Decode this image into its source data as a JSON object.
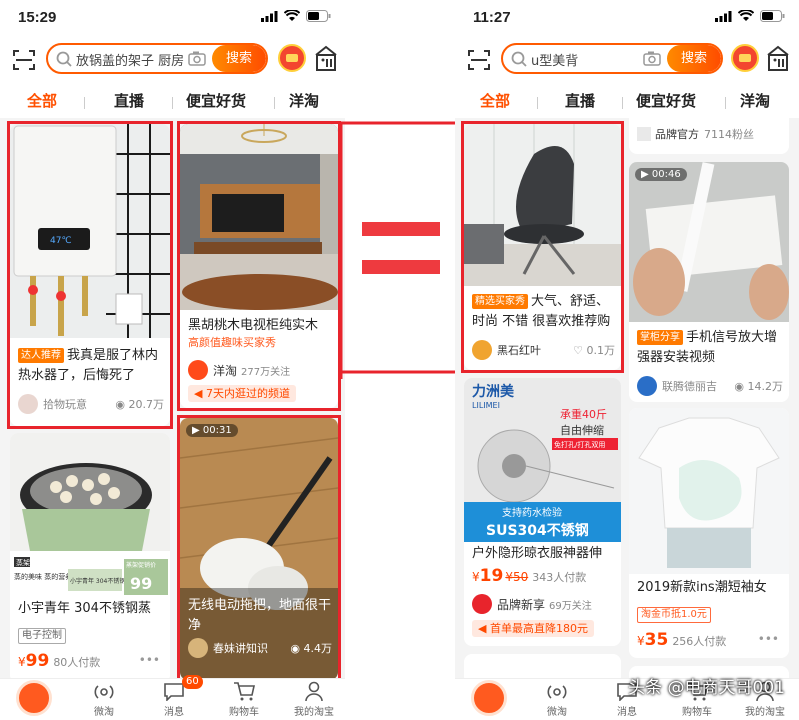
{
  "left": {
    "time": "15:29",
    "search_query": "放锅盖的架子 厨房",
    "search_button": "搜索",
    "tabs": [
      "全部",
      "直播",
      "便宜好货",
      "洋淘"
    ],
    "cards": {
      "heater": {
        "tag": "达人推荐",
        "title": "我真是服了林内热水器了，后悔死了",
        "author": "拾物玩意",
        "views": "20.7万"
      },
      "tvcabinet": {
        "title": "黑胡桃木电视柜纯实木",
        "subtitle": "高颜值趣味买家秀",
        "author": "洋淘",
        "followers": "277万关注",
        "pill": "7天内逛过的频道"
      },
      "pot": {
        "label_tag": "蒸架",
        "label_a": "蒸的美味 蒸的营养",
        "label_b": "小宇青年 304不锈钢蒸架",
        "label_c": "蒸架促销价",
        "label_price": "99",
        "title": "小宇青年 304不锈钢蒸",
        "tag": "电子控制",
        "price_symbol": "¥",
        "price": "99",
        "payers": "80人付款"
      },
      "mop": {
        "duration": "00:31",
        "title": "无线电动拖把，地面很干净",
        "author": "春妹讲知识",
        "views": "4.4万"
      }
    },
    "nav": [
      {
        "icon": "live-icon",
        "label": "微淘"
      },
      {
        "icon": "message-icon",
        "label": "消息",
        "badge": "60"
      },
      {
        "icon": "cart-icon",
        "label": "购物车"
      },
      {
        "icon": "person-icon",
        "label": "我的淘宝"
      }
    ]
  },
  "right": {
    "time": "11:27",
    "search_query": "u型美背",
    "search_button": "搜索",
    "tabs": [
      "全部",
      "直播",
      "便宜好货",
      "洋淘"
    ],
    "cards": {
      "brand_top": {
        "author": "品牌官方",
        "followers": "7114粉丝"
      },
      "chair": {
        "tag": "精选买家秀",
        "title": "大气、舒适、时尚 不错 很喜欢推荐购",
        "author": "黑石红叶",
        "likes": "0.1万"
      },
      "router": {
        "duration": "00:46",
        "tag": "掌柜分享",
        "title": "手机信号放大增强器安装视频",
        "author": "联腾德丽吉",
        "views": "14.2万"
      },
      "rack": {
        "brand": "力洲美",
        "brand_sub": "LILIMEI",
        "overlay_a": "承重40斤",
        "overlay_b": "自由伸缩",
        "overlay_c": "免打孔/打孔双用",
        "overlay_d": "支持药水检验",
        "overlay_e": "SUS304不锈钢",
        "title": "户外隐形晾衣服神器伸",
        "price_symbol": "¥",
        "price": "19",
        "old_price": "¥50",
        "payers": "343人付款",
        "author": "品牌新享",
        "followers": "69万关注",
        "pill": "首单最高直降180元"
      },
      "tshirt": {
        "title": "2019新款ins潮短袖女",
        "tag": "淘金币抵1.0元",
        "price_symbol": "¥",
        "price": "35",
        "payers": "256人付款"
      }
    },
    "nav": [
      {
        "icon": "live-icon",
        "label": "微淘"
      },
      {
        "icon": "message-icon",
        "label": "消息"
      },
      {
        "icon": "cart-icon",
        "label": "购物车"
      },
      {
        "icon": "person-icon",
        "label": "我的淘宝"
      }
    ]
  },
  "watermark": "头条 @电商天哥001",
  "colors": {
    "accent": "#ff5000",
    "highlight_box": "#e8242c",
    "equals_sign": "#ee3a3f"
  }
}
